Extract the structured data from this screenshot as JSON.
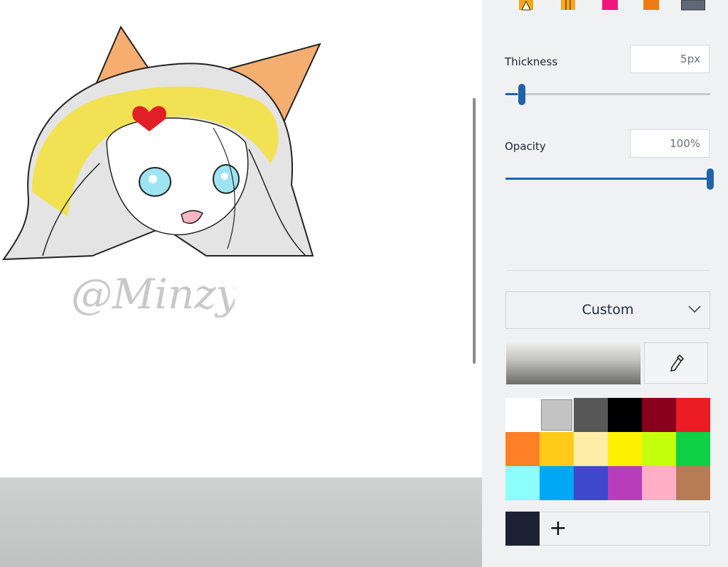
{
  "panel": {
    "thickness_label": "Thickness",
    "thickness_value": "5px",
    "thickness_fraction": 0.06,
    "opacity_label": "Opacity",
    "opacity_value": "100%",
    "opacity_fraction": 1.0,
    "palette_mode": "Custom",
    "eyedropper_icon": "eyedropper-icon",
    "add_color_label": "+"
  },
  "brushes": [
    {
      "name": "calligraphy-pen",
      "color": "#f0a61a"
    },
    {
      "name": "oil-brush",
      "color": "#f6a623"
    },
    {
      "name": "marker",
      "color": "#f0157a"
    },
    {
      "name": "crayon",
      "color": "#f07b12"
    },
    {
      "name": "pencil",
      "color": "#5f6878"
    }
  ],
  "colors": {
    "accent": "#1f63a8",
    "current": "#1d2133",
    "palette": [
      "#ffffff",
      "#c3c3c3",
      "#585858",
      "#000000",
      "#88001b",
      "#ec1c24",
      "#ff7f27",
      "#ffca18",
      "#fdeca6",
      "#fff200",
      "#c4ff0e",
      "#0ed145",
      "#8cfffb",
      "#00a8f3",
      "#3f48cc",
      "#b83dba",
      "#ffaec8",
      "#b97a56"
    ],
    "selected_index": 1
  },
  "canvas": {
    "signature": "@Minzy"
  }
}
